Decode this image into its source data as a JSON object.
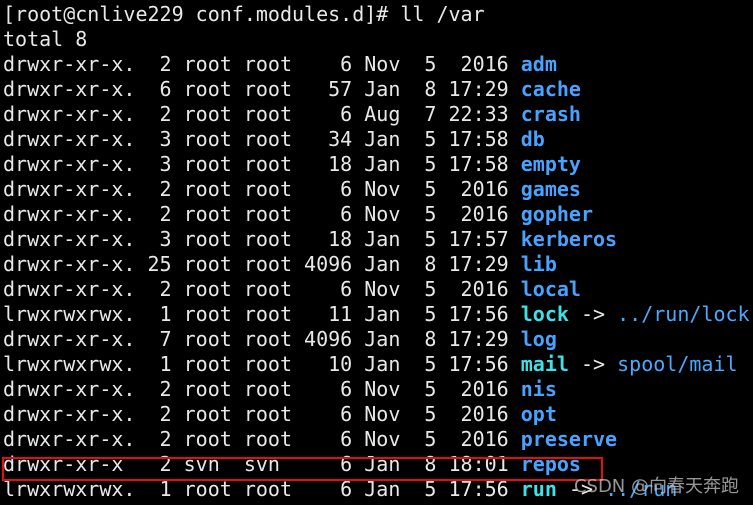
{
  "terminal": {
    "prompt": "[root@cnlive229 conf.modules.d]# ll /var",
    "total": "total 8",
    "entries": [
      {
        "meta": "drwxr-xr-x.  2 root root    6 Nov  5  2016 ",
        "name": "adm",
        "type": "dir"
      },
      {
        "meta": "drwxr-xr-x.  6 root root   57 Jan  8 17:29 ",
        "name": "cache",
        "type": "dir"
      },
      {
        "meta": "drwxr-xr-x.  2 root root    6 Aug  7 22:33 ",
        "name": "crash",
        "type": "dir"
      },
      {
        "meta": "drwxr-xr-x.  3 root root   34 Jan  5 17:58 ",
        "name": "db",
        "type": "dir"
      },
      {
        "meta": "drwxr-xr-x.  3 root root   18 Jan  5 17:58 ",
        "name": "empty",
        "type": "dir"
      },
      {
        "meta": "drwxr-xr-x.  2 root root    6 Nov  5  2016 ",
        "name": "games",
        "type": "dir"
      },
      {
        "meta": "drwxr-xr-x.  2 root root    6 Nov  5  2016 ",
        "name": "gopher",
        "type": "dir"
      },
      {
        "meta": "drwxr-xr-x.  3 root root   18 Jan  5 17:57 ",
        "name": "kerberos",
        "type": "dir"
      },
      {
        "meta": "drwxr-xr-x. 25 root root 4096 Jan  8 17:29 ",
        "name": "lib",
        "type": "dir"
      },
      {
        "meta": "drwxr-xr-x.  2 root root    6 Nov  5  2016 ",
        "name": "local",
        "type": "dir"
      },
      {
        "meta": "lrwxrwxrwx.  1 root root   11 Jan  5 17:56 ",
        "name": "lock",
        "type": "link",
        "target": "../run/lock"
      },
      {
        "meta": "drwxr-xr-x.  7 root root 4096 Jan  8 17:29 ",
        "name": "log",
        "type": "dir"
      },
      {
        "meta": "lrwxrwxrwx.  1 root root   10 Jan  5 17:56 ",
        "name": "mail",
        "type": "link",
        "target": "spool/mail"
      },
      {
        "meta": "drwxr-xr-x.  2 root root    6 Nov  5  2016 ",
        "name": "nis",
        "type": "dir"
      },
      {
        "meta": "drwxr-xr-x.  2 root root    6 Nov  5  2016 ",
        "name": "opt",
        "type": "dir"
      },
      {
        "meta": "drwxr-xr-x.  2 root root    6 Nov  5  2016 ",
        "name": "preserve",
        "type": "dir"
      },
      {
        "meta": "drwxr-xr-x   2 svn  svn     6 Jan  8 18:01 ",
        "name": "repos",
        "type": "dir",
        "highlighted": true
      },
      {
        "meta": "lrwxrwxrwx.  1 root root    6 Jan  5 17:56 ",
        "name": "run",
        "type": "link",
        "target": "../run"
      }
    ],
    "link_arrow": " -> "
  },
  "colors": {
    "background": "#000000",
    "text": "#e8e8e8",
    "dir": "#4aa2ff",
    "link": "#3fe0e6",
    "highlight_box": "#e01010"
  },
  "watermark": "CSDN @向春天奔跑"
}
